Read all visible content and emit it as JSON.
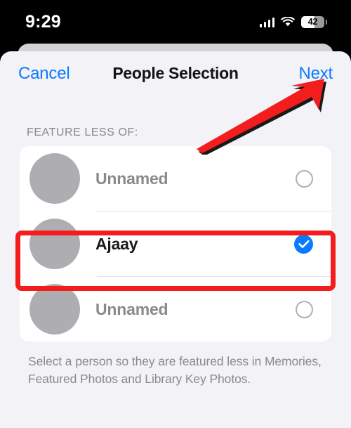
{
  "status_bar": {
    "time": "9:29",
    "cellular_icon": "cellular-signal-icon",
    "wifi_icon": "wifi-icon",
    "battery_level": "42",
    "battery_icon": "battery-icon"
  },
  "nav": {
    "cancel_label": "Cancel",
    "title": "People Selection",
    "next_label": "Next"
  },
  "section": {
    "header": "FEATURE LESS OF:"
  },
  "people": [
    {
      "name": "Unnamed",
      "selected": false,
      "avatar": "person-avatar-placeholder",
      "control_icon": "radio-unselected-icon"
    },
    {
      "name": "Ajaay",
      "selected": true,
      "avatar": "person-avatar-placeholder",
      "control_icon": "checkmark-selected-icon"
    },
    {
      "name": "Unnamed",
      "selected": false,
      "avatar": "person-avatar-placeholder",
      "control_icon": "radio-unselected-icon"
    }
  ],
  "footer": {
    "note": "Select a person so they are featured less in Memories, Featured Photos and Library Key Photos."
  },
  "annotations": {
    "highlight_box_target": "Ajaay",
    "arrow_target": "Next",
    "color": "#f41d1d"
  },
  "colors": {
    "accent_blue": "#0a7aff",
    "sheet_background": "#f2f2f7",
    "card_background": "#ffffff",
    "avatar_gray": "#aeaeb2",
    "secondary_text": "#8a8a8e",
    "annotation_red": "#f41d1d"
  }
}
